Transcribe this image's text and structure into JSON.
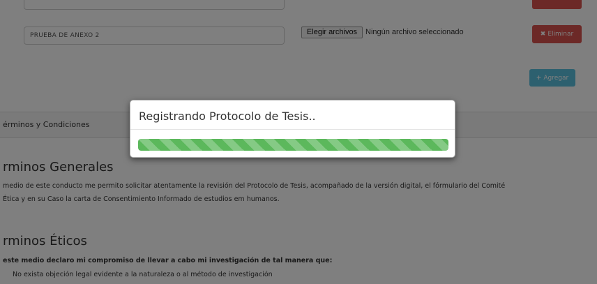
{
  "annexes": [
    {
      "name": ""
    },
    {
      "name": "PRUEBA DE ANEXO 2"
    }
  ],
  "file_input": {
    "button_label": "Elegir archivos",
    "status": "Ningún archivo seleccionado"
  },
  "buttons": {
    "delete_label": "Eliminar",
    "delete_icon": "x-icon",
    "add_label": "Agregar",
    "add_icon": "plus-icon"
  },
  "section": {
    "tab_label": "érminos y Condiciones"
  },
  "terms": {
    "general_heading": "rminos Generales",
    "general_text_1": "medio de este conducto me permito solicitar atentamente la revisión del Protocolo de Tesis, acompañado de la versión digital, el fórmulario del Comité",
    "general_text_2": "Ética y en su Caso la carta de Consentimiento Informado de estudios em humanos.",
    "ethics_heading": "rminos Éticos",
    "ethics_text": "este medio declaro mi compromiso de llevar a cabo mi investigación de tal manera que:",
    "ethics_item": "No exista objeción legal evidente a la naturaleza o al método de investigación"
  },
  "modal": {
    "title": "Registrando Protocolo de Tesis..",
    "progress": 1.0
  },
  "colors": {
    "danger": "#d9534f",
    "info": "#5bc0de",
    "success": "#5cb85c"
  }
}
